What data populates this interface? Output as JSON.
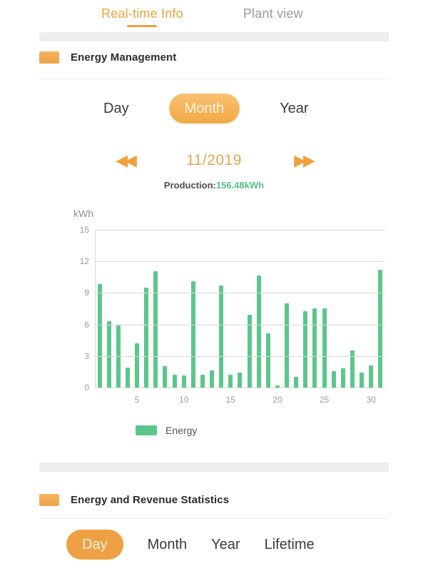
{
  "tabs": [
    {
      "label": "Real-time Info",
      "active": true
    },
    {
      "label": "Plant view",
      "active": false
    }
  ],
  "energy_management": {
    "title": "Energy Management",
    "periods": [
      {
        "label": "Day",
        "selected": false
      },
      {
        "label": "Month",
        "selected": true
      },
      {
        "label": "Year",
        "selected": false
      }
    ],
    "date_nav": {
      "prev_icon": "◀◀",
      "next_icon": "▶▶",
      "date": "11/2019"
    },
    "production_label": "Production:",
    "production_value": "156.48kWh"
  },
  "statistics": {
    "title": "Energy and Revenue Statistics",
    "periods": [
      {
        "label": "Day",
        "selected": true
      },
      {
        "label": "Month",
        "selected": false
      },
      {
        "label": "Year",
        "selected": false
      },
      {
        "label": "Lifetime",
        "selected": false
      }
    ]
  },
  "colors": {
    "accent_orange": "#f0a13c",
    "pill_orange": "#ef9f44",
    "bar_green": "#5bc68c",
    "production_green": "#53c189",
    "band_gray": "#eeeeee"
  },
  "chart_data": {
    "type": "bar",
    "title": "",
    "xlabel": "",
    "ylabel": "kWh",
    "ylim": [
      0,
      15
    ],
    "yticks": [
      0,
      3,
      6,
      9,
      12,
      15
    ],
    "xticks": [
      5,
      10,
      15,
      20,
      25,
      30
    ],
    "grid": true,
    "legend": [
      "Energy"
    ],
    "legend_position": "bottom-left",
    "categories": [
      1,
      2,
      3,
      4,
      5,
      6,
      7,
      8,
      9,
      10,
      11,
      12,
      13,
      14,
      15,
      16,
      17,
      18,
      19,
      20,
      21,
      22,
      23,
      24,
      25,
      26,
      27,
      28,
      29,
      30,
      31
    ],
    "series": [
      {
        "name": "Energy",
        "values": [
          9.9,
          6.4,
          6.0,
          2.0,
          4.3,
          9.6,
          11.1,
          2.1,
          1.3,
          1.2,
          10.2,
          1.3,
          1.7,
          9.8,
          1.3,
          1.5,
          7.0,
          10.7,
          5.2,
          0.3,
          8.1,
          1.1,
          7.3,
          7.6,
          7.6,
          1.6,
          1.9,
          3.6,
          1.5,
          2.2,
          11.3
        ]
      }
    ]
  }
}
